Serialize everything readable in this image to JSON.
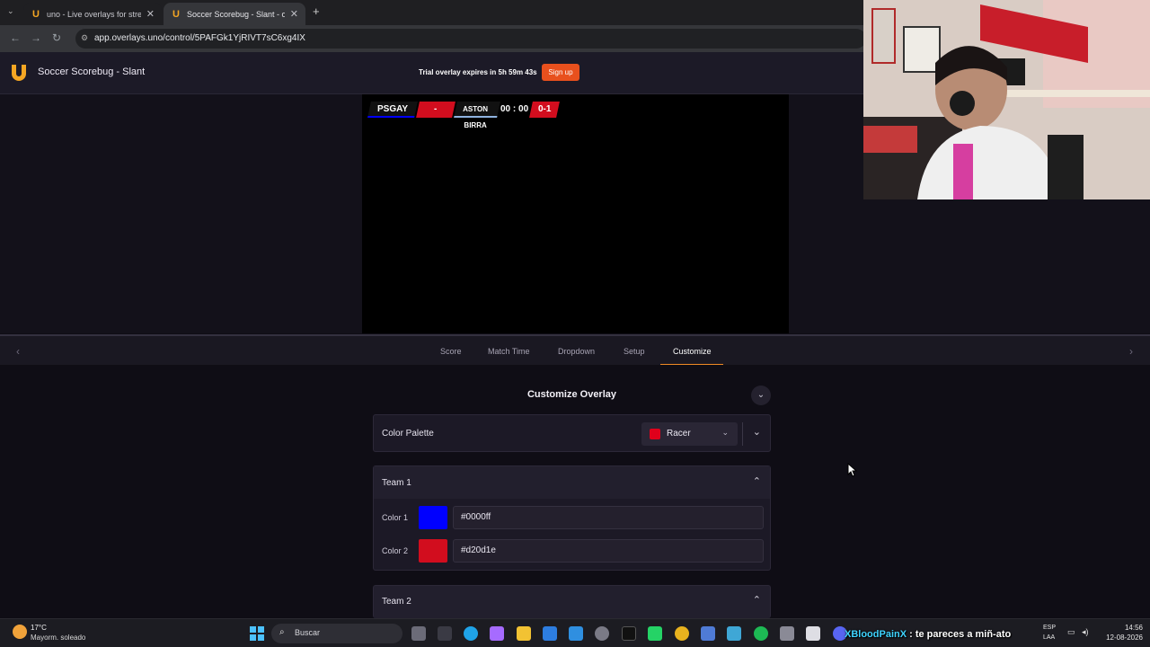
{
  "browser": {
    "tabs": [
      {
        "title": "uno - Live overlays for streamin",
        "active": false
      },
      {
        "title": "Soccer Scorebug - Slant - overl",
        "active": true
      }
    ],
    "new_tab": "+",
    "url": "app.overlays.uno/control/5PAFGk1YjRIVT7sC6xg4IX"
  },
  "app": {
    "title": "Soccer Scorebug  -  Slant",
    "trial_text": "Trial overlay expires in 5h 59m 43s",
    "signup_label": "Sign up"
  },
  "scorebug": {
    "team1": "PSGAY",
    "separator": "-",
    "team2": "ASTON BIRRA",
    "time": "00 : 00",
    "score": "0-1"
  },
  "tabs": [
    {
      "label": "Score",
      "active": false
    },
    {
      "label": "Match Time",
      "active": false
    },
    {
      "label": "Dropdown",
      "active": false
    },
    {
      "label": "Setup",
      "active": false
    },
    {
      "label": "Customize",
      "active": true
    }
  ],
  "customize": {
    "title": "Customize Overlay",
    "palette": {
      "label": "Color Palette",
      "value": "Racer",
      "swatch": "#e0001b"
    },
    "team1": {
      "label": "Team 1",
      "color1": {
        "label": "Color 1",
        "value": "#0000ff"
      },
      "color2": {
        "label": "Color 2",
        "value": "#d20d1e"
      }
    },
    "team2": {
      "label": "Team 2"
    }
  },
  "colors": {
    "accent": "#f08a24",
    "signup": "#e8501d",
    "team1_color1": "#0000ff",
    "team1_color2": "#d20d1e"
  },
  "taskbar": {
    "weather_temp": "17°C",
    "weather_desc": "Mayorm. soleado",
    "search_placeholder": "Buscar",
    "chat_user": "XBloodPainX",
    "chat_msg": ": te pareces a miñ-ato",
    "lang1": "ESP",
    "lang2": "LAA",
    "time": "14:56",
    "date": "12-08-2026"
  }
}
